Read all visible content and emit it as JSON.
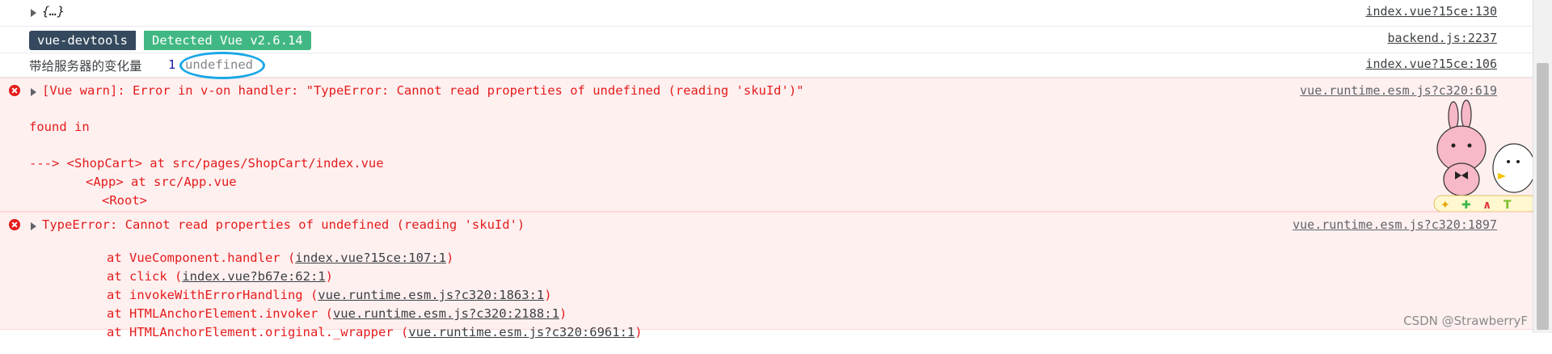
{
  "rows": {
    "obj": {
      "text": "{…}",
      "source": "index.vue?15ce:130"
    },
    "devtools": {
      "badge1": "vue-devtools",
      "badge2": "Detected Vue v2.6.14",
      "source": "backend.js:2237"
    },
    "change": {
      "label": "带给服务器的变化量",
      "count": "1",
      "value": "undefined",
      "source": "index.vue?15ce:106"
    },
    "warn": {
      "line1": "[Vue warn]: Error in v-on handler: \"TypeError: Cannot read properties of undefined (reading 'skuId')\"",
      "line2": "found in",
      "line3": "---> <ShopCart> at src/pages/ShopCart/index.vue",
      "line4": "<App> at src/App.vue",
      "line5": "<Root>",
      "source": "vue.runtime.esm.js?c320:619"
    },
    "error": {
      "line1": "TypeError: Cannot read properties of undefined (reading 'skuId')",
      "source": "vue.runtime.esm.js?c320:1897",
      "stack": [
        {
          "prefix": "at VueComponent.handler (",
          "link": "index.vue?15ce:107:1",
          "suffix": ")"
        },
        {
          "prefix": "at click (",
          "link": "index.vue?b67e:62:1",
          "suffix": ")"
        },
        {
          "prefix": "at invokeWithErrorHandling (",
          "link": "vue.runtime.esm.js?c320:1863:1",
          "suffix": ")"
        },
        {
          "prefix": "at HTMLAnchorElement.invoker (",
          "link": "vue.runtime.esm.js?c320:2188:1",
          "suffix": ")"
        },
        {
          "prefix": "at HTMLAnchorElement.original._wrapper (",
          "link": "vue.runtime.esm.js?c320:6961:1",
          "suffix": ")"
        }
      ]
    }
  },
  "watermark": "CSDN @StrawberryF",
  "colors": {
    "error_text": "#e41c1c",
    "error_bg": "#fff0f0",
    "badge_dark": "#35495e",
    "badge_green": "#41b883",
    "circle": "#1aa7e6"
  },
  "icons": [
    "expand-triangle-icon",
    "error-icon",
    "sticker-image"
  ]
}
